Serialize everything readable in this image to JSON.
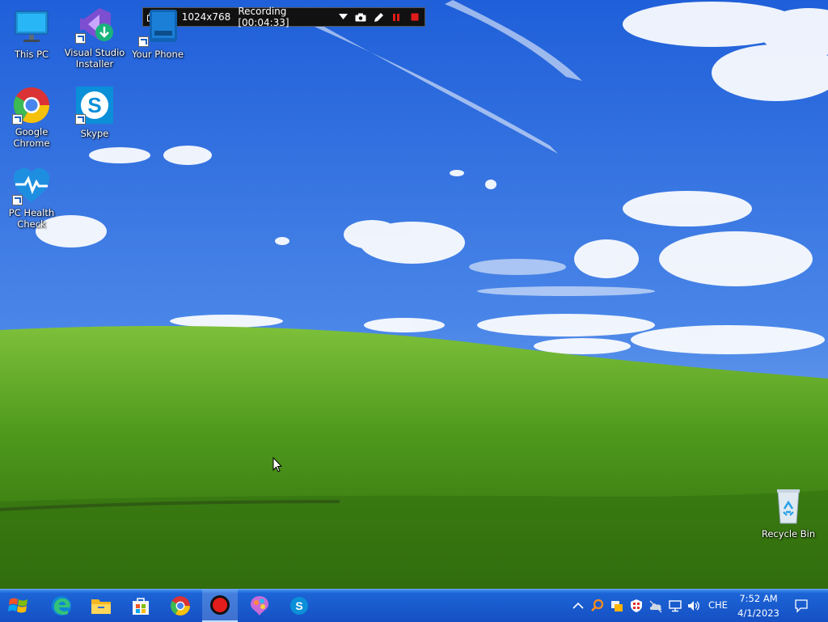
{
  "recorder": {
    "resolution": "1024x768",
    "status": "Recording [00:04:33]"
  },
  "desktop_icons": [
    {
      "name": "This PC",
      "icon": "monitor-icon"
    },
    {
      "name": "Visual Studio Installer",
      "icon": "visual-studio-icon"
    },
    {
      "name": "Your Phone",
      "icon": "phone-icon"
    },
    {
      "name": "Google Chrome",
      "icon": "chrome-icon"
    },
    {
      "name": "Skype",
      "icon": "skype-icon"
    },
    {
      "name": "PC Health Check",
      "icon": "heart-pulse-icon"
    },
    {
      "name": "Recycle Bin",
      "icon": "recycle-bin-icon"
    }
  ],
  "labels": {
    "this_pc": "This PC",
    "vs_installer": "Visual Studio Installer",
    "your_phone": "Your Phone",
    "chrome": "Google Chrome",
    "skype": "Skype",
    "pc_health": "PC Health Check",
    "recycle_bin": "Recycle Bin"
  },
  "taskbar": {
    "apps": [
      "start-icon",
      "edge-icon",
      "file-explorer-icon",
      "store-icon",
      "chrome-icon",
      "recorder-icon",
      "paint-icon",
      "skype-icon"
    ],
    "active_app": "recorder-icon",
    "language": "CHE",
    "time": "7:52 AM",
    "date": "4/1/2023"
  },
  "colors": {
    "sky": "#2f6fe0",
    "grass": "#4c9a1e",
    "taskbar": "#1a5bd0",
    "recorder_bg": "#111111"
  }
}
